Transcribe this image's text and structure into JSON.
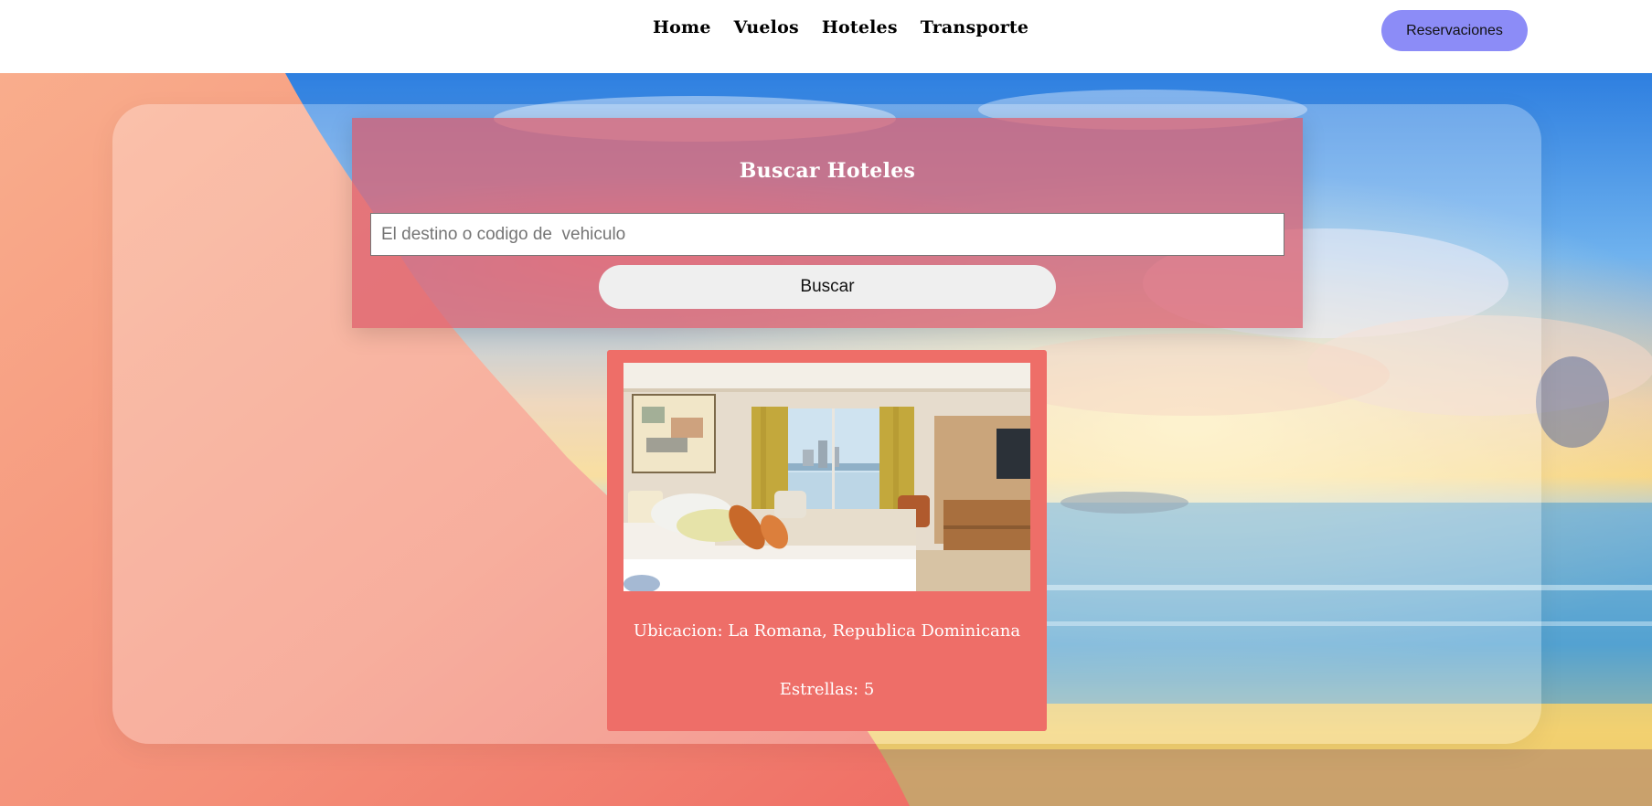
{
  "nav": {
    "items": [
      {
        "label": "Home"
      },
      {
        "label": "Vuelos"
      },
      {
        "label": "Hoteles"
      },
      {
        "label": "Transporte"
      }
    ],
    "reservations_label": "Reservaciones"
  },
  "search": {
    "title": "Buscar Hoteles",
    "placeholder": "El destino o codigo de  vehiculo",
    "button_label": "Buscar"
  },
  "hotel": {
    "photo_icon": "hotel-room-photo",
    "location": "Ubicacion: La Romana, Republica Dominicana",
    "stars": "Estrellas: 5"
  },
  "colors": {
    "accent": "#8c8cf7",
    "card": "#ee6e68",
    "search_card": "#dc5a69",
    "peach": "#f9a884",
    "sea": "#3b8fd6"
  }
}
